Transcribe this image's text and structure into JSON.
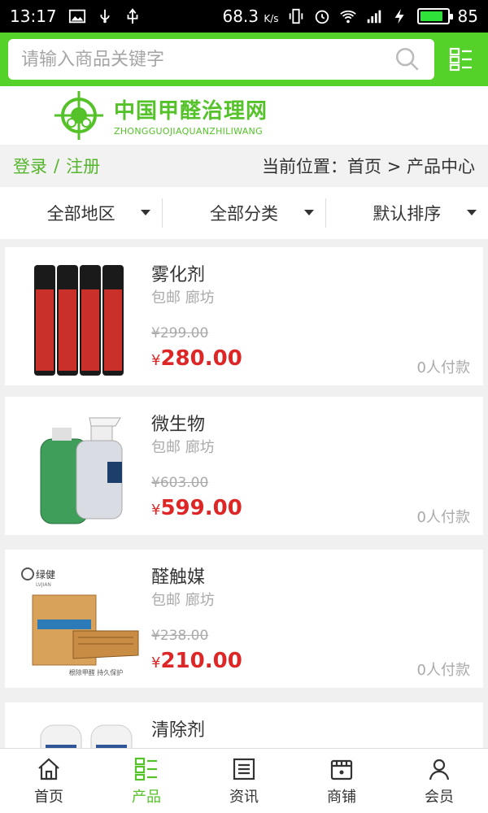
{
  "status_bar": {
    "time": "13:17",
    "net_speed": "68.3",
    "net_unit": "K/s",
    "battery": "85",
    "battery_level": 0.85,
    "icons": [
      "image-icon",
      "usb-icon",
      "vibrate-icon",
      "alarm-icon",
      "wifi-icon",
      "signal-4g-icon",
      "charging-icon",
      "battery-icon"
    ]
  },
  "search": {
    "placeholder": "请输入商品关键字"
  },
  "logo": {
    "cn": "中国甲醛治理网",
    "en": "ZHONGGUOJIAQUANZHILIWANG"
  },
  "breadcrumb": {
    "login": "登录",
    "separator": "/",
    "register": "注册",
    "location": "当前位置：首页 > 产品中心"
  },
  "filters": [
    {
      "label": "全部地区"
    },
    {
      "label": "全部分类"
    },
    {
      "label": "默认排序"
    }
  ],
  "products": [
    {
      "name": "雾化剂",
      "location": "包邮 廊坊",
      "old_price": "¥299.00",
      "price_symbol": "¥",
      "price": "280.00",
      "sold": "0人付款",
      "image": "red-bottles"
    },
    {
      "name": "微生物",
      "location": "包邮 廊坊",
      "old_price": "¥603.00",
      "price_symbol": "¥",
      "price": "599.00",
      "sold": "0人付款",
      "image": "spray-bottles"
    },
    {
      "name": "醛触媒",
      "location": "包邮 廊坊",
      "old_price": "¥238.00",
      "price_symbol": "¥",
      "price": "210.00",
      "sold": "0人付款",
      "image": "box-package",
      "image_text": {
        "brand": "绿健",
        "brand_en": "LVJIAN",
        "caption": "根除甲醛 持久保护"
      }
    },
    {
      "name": "清除剂",
      "image": "white-bottles"
    }
  ],
  "bottom_nav": [
    {
      "label": "首页",
      "icon": "home-icon"
    },
    {
      "label": "产品",
      "icon": "product-grid-icon",
      "active": true
    },
    {
      "label": "资讯",
      "icon": "news-icon"
    },
    {
      "label": "商铺",
      "icon": "store-icon"
    },
    {
      "label": "会员",
      "icon": "member-icon"
    }
  ],
  "colors": {
    "brand_green": "#55d229",
    "price_red": "#dd2727"
  }
}
